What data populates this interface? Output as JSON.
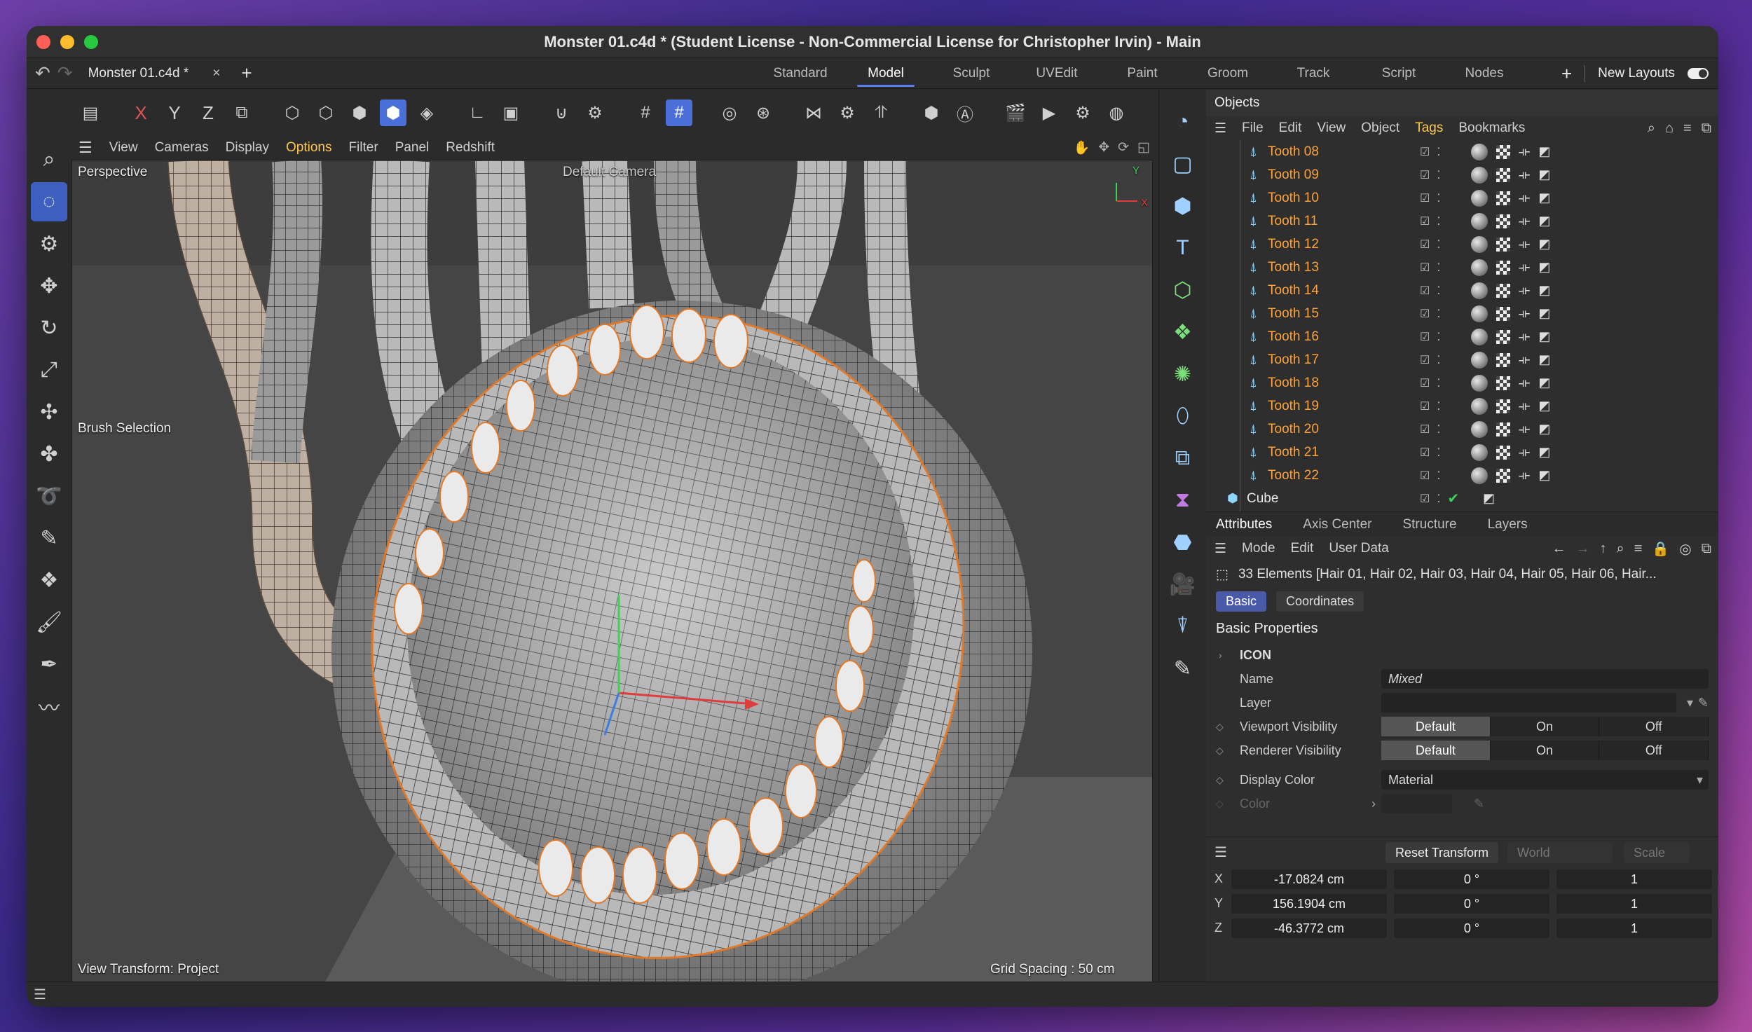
{
  "window": {
    "title": "Monster 01.c4d * (Student License - Non-Commercial License for Christopher Irvin) - Main"
  },
  "tabbar": {
    "document_tab": "Monster 01.c4d *",
    "layouts": [
      "Standard",
      "Model",
      "Sculpt",
      "UVEdit",
      "Paint",
      "Groom",
      "Track",
      "Script",
      "Nodes"
    ],
    "active_layout": "Model",
    "new_layouts": "New Layouts"
  },
  "toolbar": {
    "axis_x": "X",
    "axis_y": "Y",
    "axis_z": "Z"
  },
  "view_menu": [
    "View",
    "Cameras",
    "Display",
    "Options",
    "Filter",
    "Panel",
    "Redshift"
  ],
  "viewport": {
    "perspective": "Perspective",
    "camera": "Default Camera",
    "brush_selection": "Brush Selection",
    "view_transform": "View Transform: Project",
    "grid_spacing": "Grid Spacing : 50 cm",
    "axis_y": "Y",
    "axis_x": "X"
  },
  "objects_panel": {
    "title": "Objects",
    "menu": [
      "File",
      "Edit",
      "View",
      "Object",
      "Tags",
      "Bookmarks"
    ],
    "items": [
      {
        "name": "Tooth 08"
      },
      {
        "name": "Tooth 09"
      },
      {
        "name": "Tooth 10"
      },
      {
        "name": "Tooth 11"
      },
      {
        "name": "Tooth 12"
      },
      {
        "name": "Tooth 13"
      },
      {
        "name": "Tooth 14"
      },
      {
        "name": "Tooth 15"
      },
      {
        "name": "Tooth 16"
      },
      {
        "name": "Tooth 17"
      },
      {
        "name": "Tooth 18"
      },
      {
        "name": "Tooth 19"
      },
      {
        "name": "Tooth 20"
      },
      {
        "name": "Tooth 21"
      },
      {
        "name": "Tooth 22"
      }
    ],
    "cube": "Cube"
  },
  "attributes": {
    "tabs": [
      "Attributes",
      "Axis Center",
      "Structure",
      "Layers"
    ],
    "menu": [
      "Mode",
      "Edit",
      "User Data"
    ],
    "elements": "33 Elements [Hair 01, Hair 02, Hair 03, Hair 04, Hair 05, Hair 06, Hair...",
    "subtabs": [
      "Basic",
      "Coordinates"
    ],
    "section": "Basic Properties",
    "icon_group": "ICON",
    "name_label": "Name",
    "name_value": "Mixed",
    "layer_label": "Layer",
    "viewport_visibility": "Viewport Visibility",
    "renderer_visibility": "Renderer Visibility",
    "vis_options": [
      "Default",
      "On",
      "Off"
    ],
    "display_color_label": "Display Color",
    "display_color_value": "Material",
    "color_label": "Color"
  },
  "coordinates": {
    "reset_transform": "Reset Transform",
    "space": "World",
    "mode": "Scale",
    "rows": [
      {
        "axis": "X",
        "pos": "-17.0824 cm",
        "rot": "0 °",
        "scale": "1"
      },
      {
        "axis": "Y",
        "pos": "156.1904 cm",
        "rot": "0 °",
        "scale": "1"
      },
      {
        "axis": "Z",
        "pos": "-46.3772 cm",
        "rot": "0 °",
        "scale": "1"
      }
    ]
  },
  "colors": {
    "accent": "#4a6fd8",
    "tags_highlight": "#ffc94d",
    "selected_object": "#ffa23a"
  }
}
